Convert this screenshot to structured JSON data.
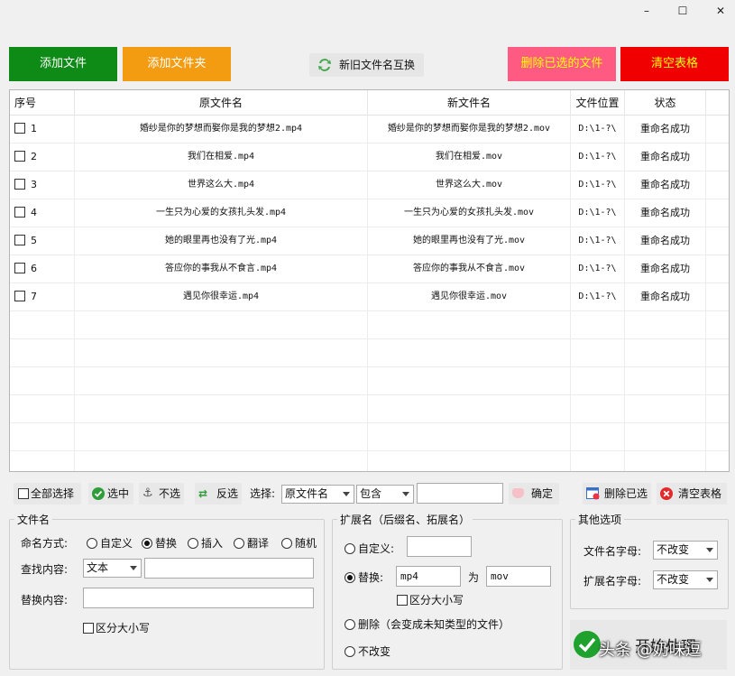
{
  "window": {
    "minimize": "–",
    "maximize": "☐",
    "close": "✕"
  },
  "top_buttons": {
    "add_file": "添加文件",
    "add_folder": "添加文件夹",
    "swap_names": "新旧文件名互换",
    "delete_selected": "删除已选的文件",
    "clear_table": "清空表格"
  },
  "colors": {
    "green": "#0e8a16",
    "orange": "#f39c12",
    "pink": "#ff5b82",
    "red": "#f10000",
    "yellow": "#ffff00"
  },
  "table": {
    "headers": [
      "序号",
      "原文件名",
      "新文件名",
      "文件位置",
      "状态"
    ],
    "rows": [
      {
        "idx": "1",
        "orig": "婚纱是你的梦想而娶你是我的梦想2.mp4",
        "new": "婚纱是你的梦想而娶你是我的梦想2.mov",
        "loc": "D:\\1-?\\",
        "status": "重命名成功"
      },
      {
        "idx": "2",
        "orig": "我们在相爱.mp4",
        "new": "我们在相爱.mov",
        "loc": "D:\\1-?\\",
        "status": "重命名成功"
      },
      {
        "idx": "3",
        "orig": "世界这么大.mp4",
        "new": "世界这么大.mov",
        "loc": "D:\\1-?\\",
        "status": "重命名成功"
      },
      {
        "idx": "4",
        "orig": "一生只为心爱的女孩扎头发.mp4",
        "new": "一生只为心爱的女孩扎头发.mov",
        "loc": "D:\\1-?\\",
        "status": "重命名成功"
      },
      {
        "idx": "5",
        "orig": "她的眼里再也没有了光.mp4",
        "new": "她的眼里再也没有了光.mov",
        "loc": "D:\\1-?\\",
        "status": "重命名成功"
      },
      {
        "idx": "6",
        "orig": "答应你的事我从不食言.mp4",
        "new": "答应你的事我从不食言.mov",
        "loc": "D:\\1-?\\",
        "status": "重命名成功"
      },
      {
        "idx": "7",
        "orig": "遇见你很幸运.mp4",
        "new": "遇见你很幸运.mov",
        "loc": "D:\\1-?\\",
        "status": "重命名成功"
      }
    ]
  },
  "toolbar": {
    "select_all": "全部选择",
    "select": "选中",
    "unselect": "不选",
    "invert": "反选",
    "choose_label": "选择:",
    "field_select": "原文件名",
    "op_select": "包含",
    "filter_value": "",
    "confirm": "确定",
    "delete_selected": "删除已选",
    "clear_table": "清空表格"
  },
  "filename_group": {
    "title": "文件名",
    "mode_label": "命名方式:",
    "modes": [
      "自定义",
      "替换",
      "插入",
      "翻译",
      "随机"
    ],
    "selected_mode": "替换",
    "find_label": "查找内容:",
    "find_type": "文本",
    "find_value": "",
    "replace_label": "替换内容:",
    "replace_value": "",
    "case_sensitive": "区分大小写"
  },
  "ext_group": {
    "title": "扩展名（后缀名、拓展名）",
    "custom": "自定义:",
    "custom_value": "",
    "replace": "替换:",
    "replace_from": "mp4",
    "to": "为",
    "replace_to": "mov",
    "case_sensitive": "区分大小写",
    "delete": "删除（会变成未知类型的文件）",
    "no_change": "不改变"
  },
  "other_group": {
    "title": "其他选项",
    "filename_case_label": "文件名字母:",
    "filename_case": "不改变",
    "ext_case_label": "扩展名字母:",
    "ext_case": "不改变"
  },
  "start": {
    "label": "开始处理"
  },
  "watermark": "头条 @奶味逗"
}
